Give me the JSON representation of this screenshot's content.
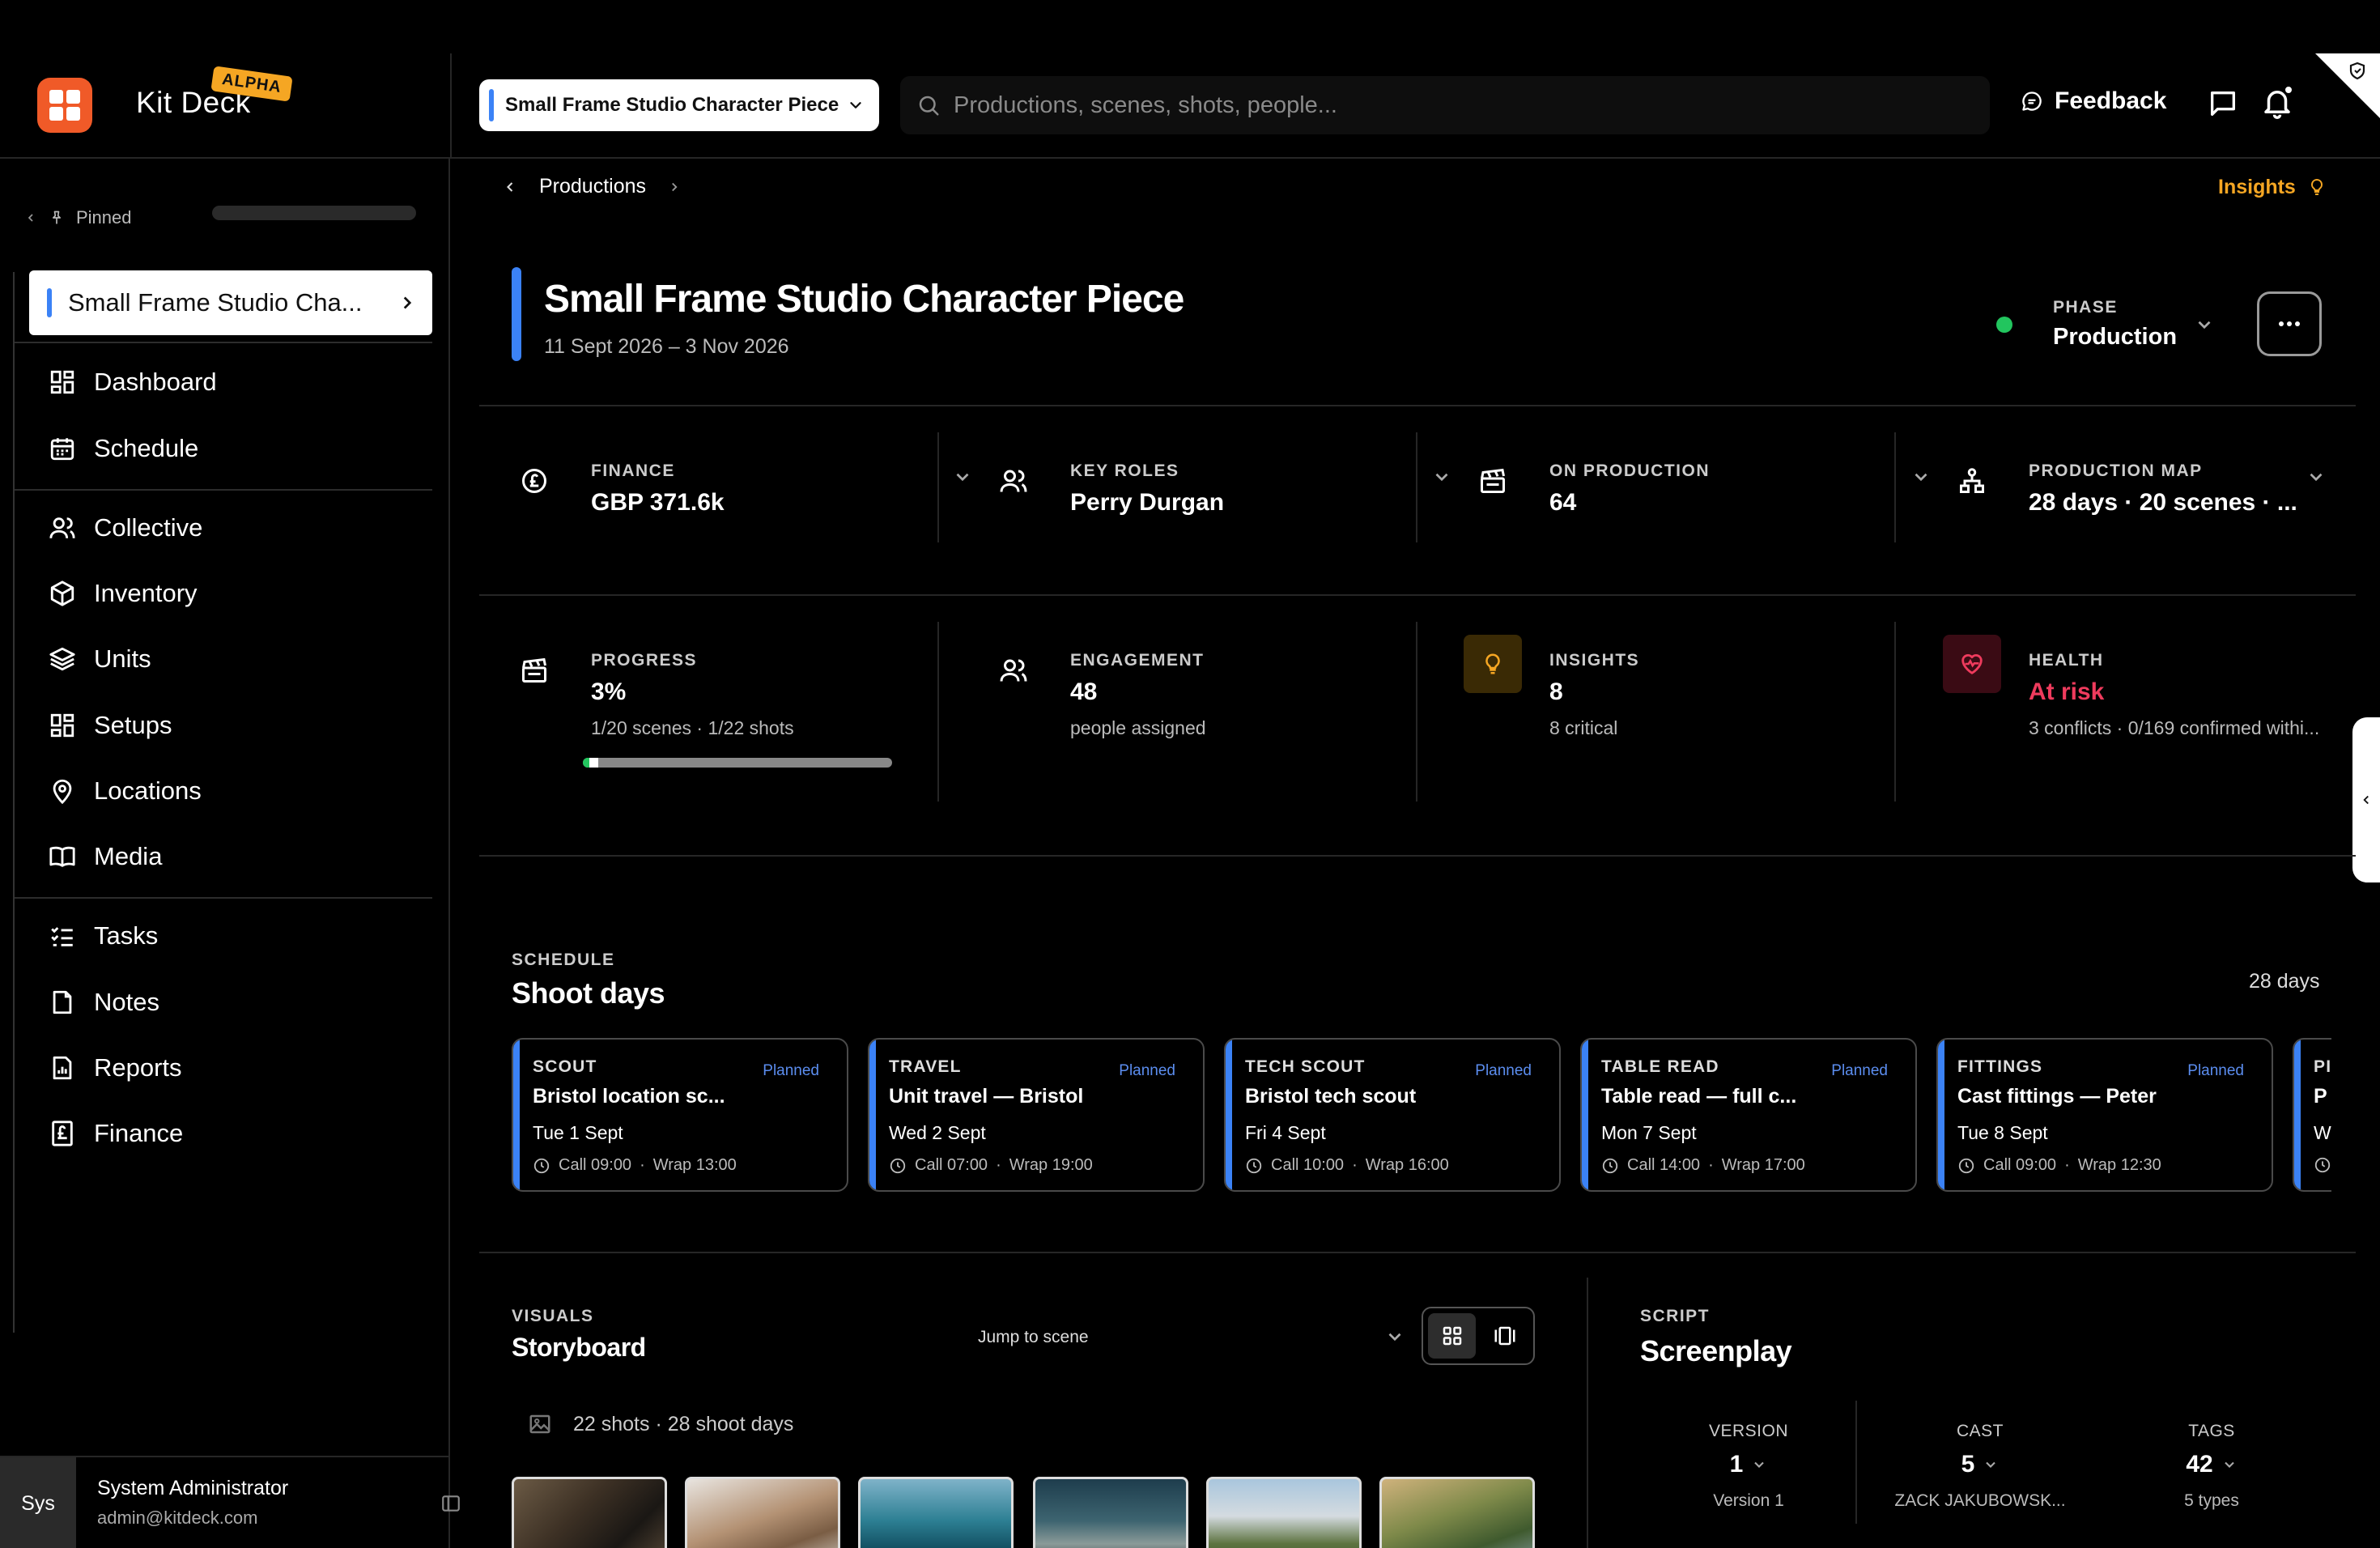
{
  "brand": {
    "name": "Kit Deck",
    "badge": "ALPHA"
  },
  "header": {
    "project_select": "Small Frame Studio Character Piece",
    "search_placeholder": "Productions, scenes, shots, people...",
    "feedback_label": "Feedback"
  },
  "sidebar": {
    "pinned_label": "Pinned",
    "project_label": "Small Frame Studio Cha...",
    "groups": [
      [
        {
          "label": "Dashboard",
          "icon": "dashboard-icon"
        },
        {
          "label": "Schedule",
          "icon": "calendar-icon"
        }
      ],
      [
        {
          "label": "Collective",
          "icon": "people-icon"
        },
        {
          "label": "Inventory",
          "icon": "box-icon"
        },
        {
          "label": "Units",
          "icon": "layers-icon"
        },
        {
          "label": "Setups",
          "icon": "grid-icon"
        },
        {
          "label": "Locations",
          "icon": "pin-icon"
        },
        {
          "label": "Media",
          "icon": "book-icon"
        }
      ],
      [
        {
          "label": "Tasks",
          "icon": "tasks-icon"
        },
        {
          "label": "Notes",
          "icon": "note-icon"
        },
        {
          "label": "Reports",
          "icon": "report-icon"
        },
        {
          "label": "Finance",
          "icon": "pound-icon"
        }
      ]
    ],
    "user": {
      "initials": "Sys",
      "name": "System Administrator",
      "email": "admin@kitdeck.com"
    }
  },
  "breadcrumb": {
    "item": "Productions"
  },
  "insights_link": "Insights",
  "project": {
    "title": "Small Frame Studio Character Piece",
    "dates": "11 Sept 2026 – 3 Nov 2026",
    "phase_label": "PHASE",
    "phase_value": "Production"
  },
  "stats_row1": [
    {
      "label": "FINANCE",
      "value": "GBP 371.6k",
      "icon": "pound-circle-icon"
    },
    {
      "label": "KEY ROLES",
      "value": "Perry Durgan",
      "icon": "people-icon"
    },
    {
      "label": "ON PRODUCTION",
      "value": "64",
      "icon": "clapper-icon"
    },
    {
      "label": "PRODUCTION MAP",
      "value": "28 days · 20 scenes · ...",
      "icon": "sitemap-icon"
    }
  ],
  "stats_row2": [
    {
      "label": "PROGRESS",
      "value": "3%",
      "sub": "1/20 scenes · 1/22 shots",
      "icon": "clapper-icon",
      "progress": 0.05
    },
    {
      "label": "ENGAGEMENT",
      "value": "48",
      "sub": "people assigned",
      "icon": "people-icon"
    },
    {
      "label": "INSIGHTS",
      "value": "8",
      "sub": "8 critical",
      "icon": "bulb-icon"
    },
    {
      "label": "HEALTH",
      "value": "At risk",
      "sub": "3 conflicts · 0/169 confirmed withi...",
      "icon": "heart-pulse-icon"
    }
  ],
  "schedule": {
    "kicker": "SCHEDULE",
    "title": "Shoot days",
    "count": "28 days",
    "days": [
      {
        "type": "SCOUT",
        "status": "Planned",
        "title": "Bristol location sc...",
        "date": "Tue 1 Sept",
        "call": "Call 09:00",
        "wrap": "Wrap 13:00"
      },
      {
        "type": "TRAVEL",
        "status": "Planned",
        "title": "Unit travel — Bristol",
        "date": "Wed 2 Sept",
        "call": "Call 07:00",
        "wrap": "Wrap 19:00"
      },
      {
        "type": "TECH SCOUT",
        "status": "Planned",
        "title": "Bristol tech scout",
        "date": "Fri 4 Sept",
        "call": "Call 10:00",
        "wrap": "Wrap 16:00"
      },
      {
        "type": "TABLE READ",
        "status": "Planned",
        "title": "Table read — full c...",
        "date": "Mon 7 Sept",
        "call": "Call 14:00",
        "wrap": "Wrap 17:00"
      },
      {
        "type": "FITTINGS",
        "status": "Planned",
        "title": "Cast fittings — Peter",
        "date": "Tue 8 Sept",
        "call": "Call 09:00",
        "wrap": "Wrap 12:30"
      },
      {
        "type": "PI",
        "status": "",
        "title": "P",
        "date": "W",
        "call": "",
        "wrap": ""
      }
    ]
  },
  "visuals": {
    "kicker": "VISUALS",
    "title": "Storyboard",
    "jump_label": "Jump to scene",
    "meta": "22 shots · 28 shoot days"
  },
  "script": {
    "kicker": "SCRIPT",
    "title": "Screenplay",
    "columns": [
      {
        "label": "VERSION",
        "value": "1",
        "sub": "Version 1"
      },
      {
        "label": "CAST",
        "value": "5",
        "sub": "ZACK JAKUBOWSK..."
      },
      {
        "label": "TAGS",
        "value": "42",
        "sub": "5 types"
      }
    ]
  },
  "colors": {
    "accent_blue": "#3b82f6",
    "brand_orange": "#f05a28",
    "insight_amber": "#f5a623",
    "risk_red": "#ef3b5d",
    "ok_green": "#22c55e"
  }
}
